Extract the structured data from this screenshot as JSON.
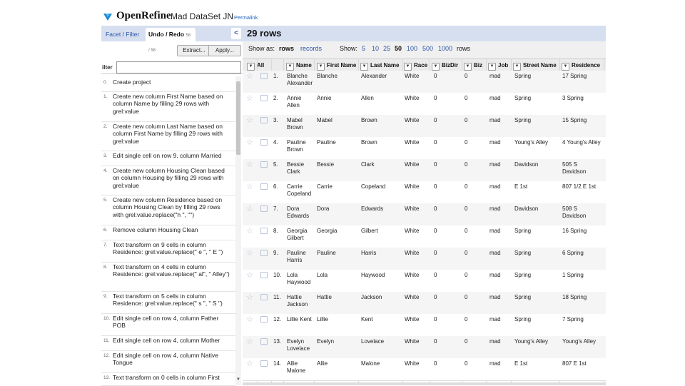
{
  "app": {
    "logo_text": "OpenRefine",
    "project_name": "Mad DataSet JN",
    "permalink": "Permalink"
  },
  "left_panel": {
    "tab_facet": "Facet / Filter",
    "tab_undo": "Undo / Redo",
    "tab_undo_count": "58 / 58",
    "collapse_glyph": "<",
    "extract_label": "Extract...",
    "apply_label": "Apply...",
    "filter_label": "ilter",
    "filter_placeholder": "",
    "history": [
      {
        "num": "0.",
        "text": "Create project"
      },
      {
        "num": "1.",
        "text": "Create new column First Name based on column Name by filling 29 rows with grel:value"
      },
      {
        "num": "2.",
        "text": "Create new column Last Name based on column First Name by filling 29 rows with grel:value"
      },
      {
        "num": "3.",
        "text": "Edit single cell on row 9, column Married"
      },
      {
        "num": "4.",
        "text": "Create new column Housing Clean based on column Housing by filling 29 rows with grel:value"
      },
      {
        "num": "5.",
        "text": "Create new column Residence based on column Housing Clean by filling 29 rows with grel:value.replace(\"h \", \"\")"
      },
      {
        "num": "6.",
        "text": "Remove column Housing Clean"
      },
      {
        "num": "7.",
        "text": "Text transform on 9 cells in column Residence: grel:value.replace(\" e \", \" E \")"
      },
      {
        "num": "8.",
        "text": "Text transform on 4 cells in column Residence: grel:value.replace(\" al\", \" Alley\")"
      },
      {
        "num": "9.",
        "text": "Text transform on 5 cells in column Residence: grel:value.replace(\" s \", \" S \")"
      },
      {
        "num": "10.",
        "text": "Edit single cell on row 4, column Father POB"
      },
      {
        "num": "11.",
        "text": "Edit single cell on row 4, column Mother"
      },
      {
        "num": "12.",
        "text": "Edit single cell on row 4, column Native Tongue"
      },
      {
        "num": "13.",
        "text": "Text transform on 0 cells in column First"
      }
    ]
  },
  "data_panel": {
    "rows_count": "29 rows",
    "show_as_label": "Show as:",
    "show_as_rows": "rows",
    "show_as_records": "records",
    "show_label": "Show:",
    "page_sizes": [
      "5",
      "10",
      "25",
      "50",
      "100",
      "500",
      "1000"
    ],
    "page_size_selected": "50",
    "rows_suffix": "rows",
    "columns": [
      "All",
      "Name",
      "First Name",
      "Last Name",
      "Race",
      "BizDir",
      "Biz",
      "Job",
      "Street Name",
      "Residence"
    ],
    "rows": [
      {
        "n": "1.",
        "name": "Blanche Alexander",
        "first": "Blanche",
        "last": "Alexander",
        "race": "White",
        "bizdir": "0",
        "biz": "0",
        "job": "mad",
        "street": "Spring",
        "res": "17 Spring"
      },
      {
        "n": "2.",
        "name": "Annie Allen",
        "first": "Annie",
        "last": "Allen",
        "race": "White",
        "bizdir": "0",
        "biz": "0",
        "job": "mad",
        "street": "Spring",
        "res": "3 Spring"
      },
      {
        "n": "3.",
        "name": "Mabel Brown",
        "first": "Mabel",
        "last": "Brown",
        "race": "White",
        "bizdir": "0",
        "biz": "0",
        "job": "mad",
        "street": "Spring",
        "res": "15 Spring"
      },
      {
        "n": "4.",
        "name": "Pauline Brown",
        "first": "Pauline",
        "last": "Brown",
        "race": "White",
        "bizdir": "0",
        "biz": "0",
        "job": "mad",
        "street": "Young's Alley",
        "res": "4 Young's Alley"
      },
      {
        "n": "5.",
        "name": "Bessie Clark",
        "first": "Bessie",
        "last": "Clark",
        "race": "White",
        "bizdir": "0",
        "biz": "0",
        "job": "mad",
        "street": "Davidson",
        "res": "505 S Davidson"
      },
      {
        "n": "6.",
        "name": "Carrie Copeland",
        "first": "Carrie",
        "last": "Copeland",
        "race": "White",
        "bizdir": "0",
        "biz": "0",
        "job": "mad",
        "street": "E 1st",
        "res": "807 1/2 E 1st"
      },
      {
        "n": "7.",
        "name": "Dora Edwards",
        "first": "Dora",
        "last": "Edwards",
        "race": "White",
        "bizdir": "0",
        "biz": "0",
        "job": "mad",
        "street": "Davidson",
        "res": "508 S Davidson"
      },
      {
        "n": "8.",
        "name": "Georgia Gilbert",
        "first": "Georgia",
        "last": "Gilbert",
        "race": "White",
        "bizdir": "0",
        "biz": "0",
        "job": "mad",
        "street": "Spring",
        "res": "16 Spring"
      },
      {
        "n": "9.",
        "name": "Pauline Harris",
        "first": "Pauline",
        "last": "Harris",
        "race": "White",
        "bizdir": "0",
        "biz": "0",
        "job": "mad",
        "street": "Spring",
        "res": "6 Spring"
      },
      {
        "n": "10.",
        "name": "Lola Haywood",
        "first": "Lola",
        "last": "Haywood",
        "race": "White",
        "bizdir": "0",
        "biz": "0",
        "job": "mad",
        "street": "Spring",
        "res": "1 Spring"
      },
      {
        "n": "11.",
        "name": "Hattie Jackson",
        "first": "Hattie",
        "last": "Jackson",
        "race": "White",
        "bizdir": "0",
        "biz": "0",
        "job": "mad",
        "street": "Spring",
        "res": "18 Spring"
      },
      {
        "n": "12.",
        "name": "Lillie Kent",
        "first": "Lillie",
        "last": "Kent",
        "race": "White",
        "bizdir": "0",
        "biz": "0",
        "job": "mad",
        "street": "Spring",
        "res": "7 Spring"
      },
      {
        "n": "13.",
        "name": "Evelyn Lovelace",
        "first": "Evelyn",
        "last": "Lovelace",
        "race": "White",
        "bizdir": "0",
        "biz": "0",
        "job": "mad",
        "street": "Young's Alley",
        "res": "Young's Alley"
      },
      {
        "n": "14.",
        "name": "Allie Malone",
        "first": "Allie",
        "last": "Malone",
        "race": "White",
        "bizdir": "0",
        "biz": "0",
        "job": "mad",
        "street": "E 1st",
        "res": "807 E 1st"
      }
    ]
  },
  "colors": {
    "accent": "#2c55a8",
    "header_bg": "#d6dff0",
    "logo_blue": "#1a8ad4"
  }
}
